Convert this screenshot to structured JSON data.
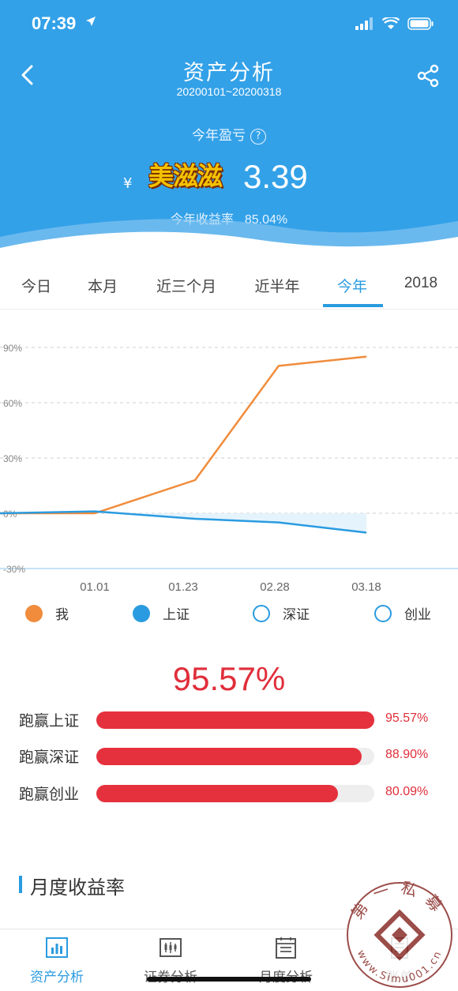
{
  "status": {
    "time": "07:39",
    "location_icon": "location-arrow-icon"
  },
  "nav": {
    "title": "资产分析",
    "date_range": "20200101~20200318"
  },
  "summary": {
    "label": "今年盈亏",
    "help": "?",
    "currency": "¥",
    "sticker_text": "美滋滋",
    "amount_visible": "3.39",
    "rate_label": "今年收益率",
    "rate_value": "85.04%"
  },
  "tabs": [
    "今日",
    "本月",
    "近三个月",
    "近半年",
    "今年",
    "2018"
  ],
  "active_tab": "今年",
  "chart_data": {
    "type": "line",
    "x": [
      "01.01",
      "01.23",
      "02.28",
      "03.18"
    ],
    "y_ticks": [
      "90%",
      "60%",
      "30%",
      "0%",
      "-30%"
    ],
    "ylim": [
      -30,
      90
    ],
    "series": [
      {
        "name": "我",
        "color": "#f08c3c",
        "points": [
          [
            0,
            0
          ],
          [
            0.7,
            0
          ],
          [
            1.9,
            18
          ],
          [
            2.9,
            80
          ],
          [
            3.95,
            85
          ]
        ]
      },
      {
        "name": "上证",
        "color": "#2a9be0",
        "points": [
          [
            0,
            0
          ],
          [
            0.7,
            1
          ],
          [
            1.9,
            -3
          ],
          [
            2.9,
            -5
          ],
          [
            3.95,
            -10.5
          ]
        ]
      }
    ],
    "legend": [
      {
        "name": "我",
        "color": "#f08c3c",
        "filled": true
      },
      {
        "name": "上证",
        "color": "#2a9be0",
        "filled": true
      },
      {
        "name": "深证",
        "color": "#2a9be0",
        "filled": false
      },
      {
        "name": "创业",
        "color": "#2a9be0",
        "filled": false
      }
    ]
  },
  "win_summary": {
    "headline": "95.57%"
  },
  "win_bars": [
    {
      "label": "跑赢上证",
      "value": "95.57%",
      "fraction": 1.0
    },
    {
      "label": "跑赢深证",
      "value": "88.90%",
      "fraction": 0.955
    },
    {
      "label": "跑赢创业",
      "value": "80.09%",
      "fraction": 0.868
    }
  ],
  "section": {
    "title": "月度收益率"
  },
  "bottom_nav": [
    {
      "label": "资产分析",
      "icon": "bar-chart-icon",
      "active": true
    },
    {
      "label": "证券分析",
      "icon": "candlestick-icon",
      "active": false
    },
    {
      "label": "月度分析",
      "icon": "calendar-doc-icon",
      "active": false
    },
    {
      "label": "账单",
      "icon": "bill-icon",
      "active": false
    }
  ],
  "watermark": {
    "top_text": "第一私募",
    "bottom_text": "www.Simu001.cn"
  }
}
